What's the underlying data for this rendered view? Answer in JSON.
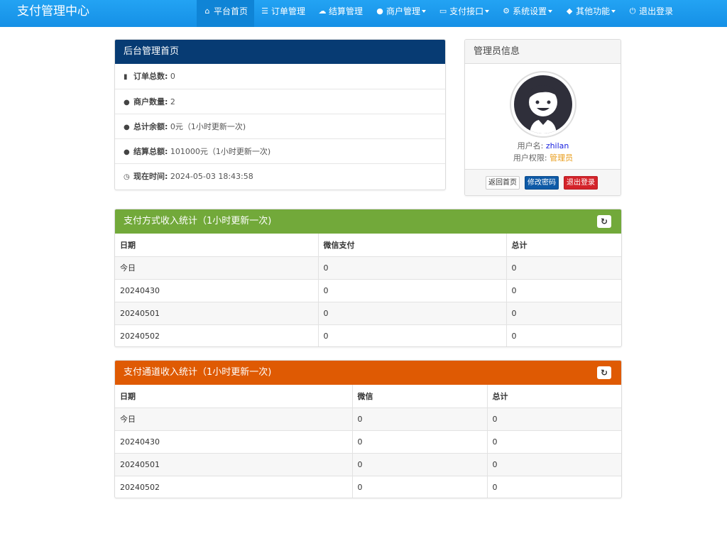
{
  "brand": "支付管理中心",
  "nav": [
    {
      "icon": "home-icon",
      "glyph": "⌂",
      "label": "平台首页",
      "active": true
    },
    {
      "icon": "list-icon",
      "glyph": "☰",
      "label": "订单管理"
    },
    {
      "icon": "cloud-icon",
      "glyph": "☁",
      "label": "结算管理"
    },
    {
      "icon": "user-icon",
      "glyph": "●",
      "label": "商户管理",
      "dropdown": true
    },
    {
      "icon": "credit-card-icon",
      "glyph": "▭",
      "label": "支付接口",
      "dropdown": true
    },
    {
      "icon": "gear-icon",
      "glyph": "⚙",
      "label": "系统设置",
      "dropdown": true
    },
    {
      "icon": "cube-icon",
      "glyph": "◆",
      "label": "其他功能",
      "dropdown": true
    },
    {
      "icon": "power-icon",
      "glyph": "⏻",
      "label": "退出登录"
    }
  ],
  "overview": {
    "title": "后台管理首页",
    "rows": [
      {
        "icon": "bar-chart-icon",
        "glyph": "▮",
        "label": "订单总数:",
        "value": "0"
      },
      {
        "icon": "drop-icon",
        "glyph": "●",
        "label": "商户数量:",
        "value": "2"
      },
      {
        "icon": "drop-icon",
        "glyph": "●",
        "label": "总计余额:",
        "value": "0元（1小时更新一次)"
      },
      {
        "icon": "drop-icon",
        "glyph": "●",
        "label": "结算总额:",
        "value": "101000元（1小时更新一次)"
      },
      {
        "icon": "clock-icon",
        "glyph": "◷",
        "label": "现在时间:",
        "value": " 2024-05-03 18:43:58"
      }
    ]
  },
  "admin": {
    "title": "管理员信息",
    "username_label": "用户名:",
    "username": "zhilan",
    "role_label": "用户权限:",
    "role": "管理员",
    "btn_home": "返回首页",
    "btn_password": "修改密码",
    "btn_logout": "退出登录"
  },
  "pay_method_stats": {
    "title": "支付方式收入统计（1小时更新一次)",
    "refresh_glyph": "↻",
    "headers": [
      "日期",
      "微信支付",
      "总计"
    ],
    "rows": [
      [
        "今日",
        "0",
        "0"
      ],
      [
        "20240430",
        "0",
        "0"
      ],
      [
        "20240501",
        "0",
        "0"
      ],
      [
        "20240502",
        "0",
        "0"
      ]
    ]
  },
  "channel_stats": {
    "title": "支付通道收入统计（1小时更新一次)",
    "refresh_glyph": "↻",
    "headers": [
      "日期",
      "微信",
      "总计"
    ],
    "rows": [
      [
        "今日",
        "0",
        "0"
      ],
      [
        "20240430",
        "0",
        "0"
      ],
      [
        "20240501",
        "0",
        "0"
      ],
      [
        "20240502",
        "0",
        "0"
      ]
    ]
  }
}
